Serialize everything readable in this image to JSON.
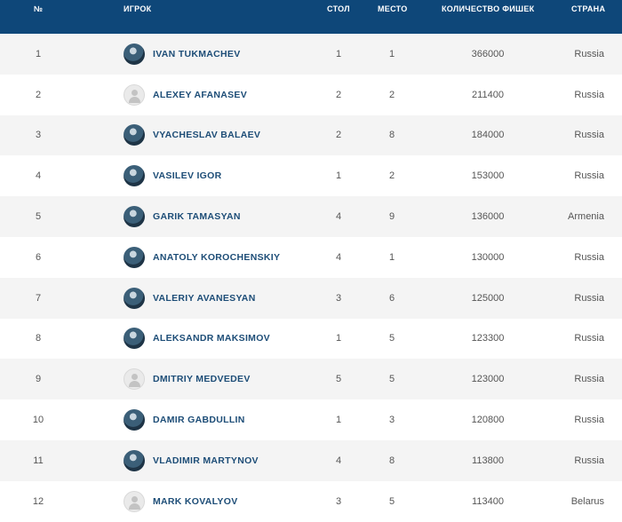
{
  "header": {
    "num": "№",
    "player": "ИГРОК",
    "table": "СТОЛ",
    "seat": "МЕСТО",
    "chips": "КОЛИЧЕСТВО ФИШЕК",
    "country": "СТРАНА"
  },
  "rows": [
    {
      "num": "1",
      "name": "IVAN TUKMACHEV",
      "table": "1",
      "seat": "1",
      "chips": "366000",
      "country": "Russia",
      "avatar": "photo"
    },
    {
      "num": "2",
      "name": "ALEXEY AFANASEV",
      "table": "2",
      "seat": "2",
      "chips": "211400",
      "country": "Russia",
      "avatar": "placeholder"
    },
    {
      "num": "3",
      "name": "VYACHESLAV BALAEV",
      "table": "2",
      "seat": "8",
      "chips": "184000",
      "country": "Russia",
      "avatar": "photo"
    },
    {
      "num": "4",
      "name": "VASILEV IGOR",
      "table": "1",
      "seat": "2",
      "chips": "153000",
      "country": "Russia",
      "avatar": "photo"
    },
    {
      "num": "5",
      "name": "GARIK TAMASYAN",
      "table": "4",
      "seat": "9",
      "chips": "136000",
      "country": "Armenia",
      "avatar": "photo"
    },
    {
      "num": "6",
      "name": "ANATOLY KOROCHENSKIY",
      "table": "4",
      "seat": "1",
      "chips": "130000",
      "country": "Russia",
      "avatar": "photo"
    },
    {
      "num": "7",
      "name": "VALERIY AVANESYAN",
      "table": "3",
      "seat": "6",
      "chips": "125000",
      "country": "Russia",
      "avatar": "photo"
    },
    {
      "num": "8",
      "name": "ALEKSANDR MAKSIMOV",
      "table": "1",
      "seat": "5",
      "chips": "123300",
      "country": "Russia",
      "avatar": "photo"
    },
    {
      "num": "9",
      "name": "DMITRIY MEDVEDEV",
      "table": "5",
      "seat": "5",
      "chips": "123000",
      "country": "Russia",
      "avatar": "placeholder"
    },
    {
      "num": "10",
      "name": "DAMIR GABDULLIN",
      "table": "1",
      "seat": "3",
      "chips": "120800",
      "country": "Russia",
      "avatar": "photo"
    },
    {
      "num": "11",
      "name": "VLADIMIR MARTYNOV",
      "table": "4",
      "seat": "8",
      "chips": "113800",
      "country": "Russia",
      "avatar": "photo"
    },
    {
      "num": "12",
      "name": "MARK KOVALYOV",
      "table": "3",
      "seat": "5",
      "chips": "113400",
      "country": "Belarus",
      "avatar": "placeholder"
    }
  ]
}
